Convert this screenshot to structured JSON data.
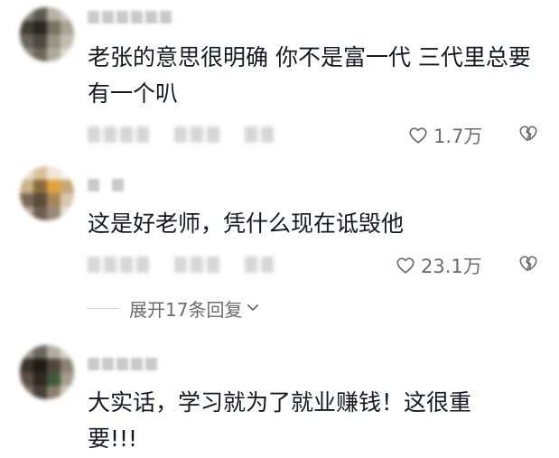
{
  "comments": [
    {
      "text": "老张的意思很明确 你不是富一代 三代里总要有一个叭",
      "likes": "1.7万"
    },
    {
      "text": "这是好老师，凭什么现在诋毁他",
      "likes": "23.1万"
    },
    {
      "text": "大实话，学习就为了就业赚钱！这很重要!!!"
    }
  ],
  "expand": {
    "label": "展开17条回复"
  },
  "icons": {
    "like": "heart-outline-icon",
    "dislike": "broken-heart-icon",
    "expand": "chevron-down-icon"
  },
  "colors": {
    "text": "#161823",
    "secondary": "#6b6b6b",
    "placeholder_blur": "#c9c9c9"
  }
}
